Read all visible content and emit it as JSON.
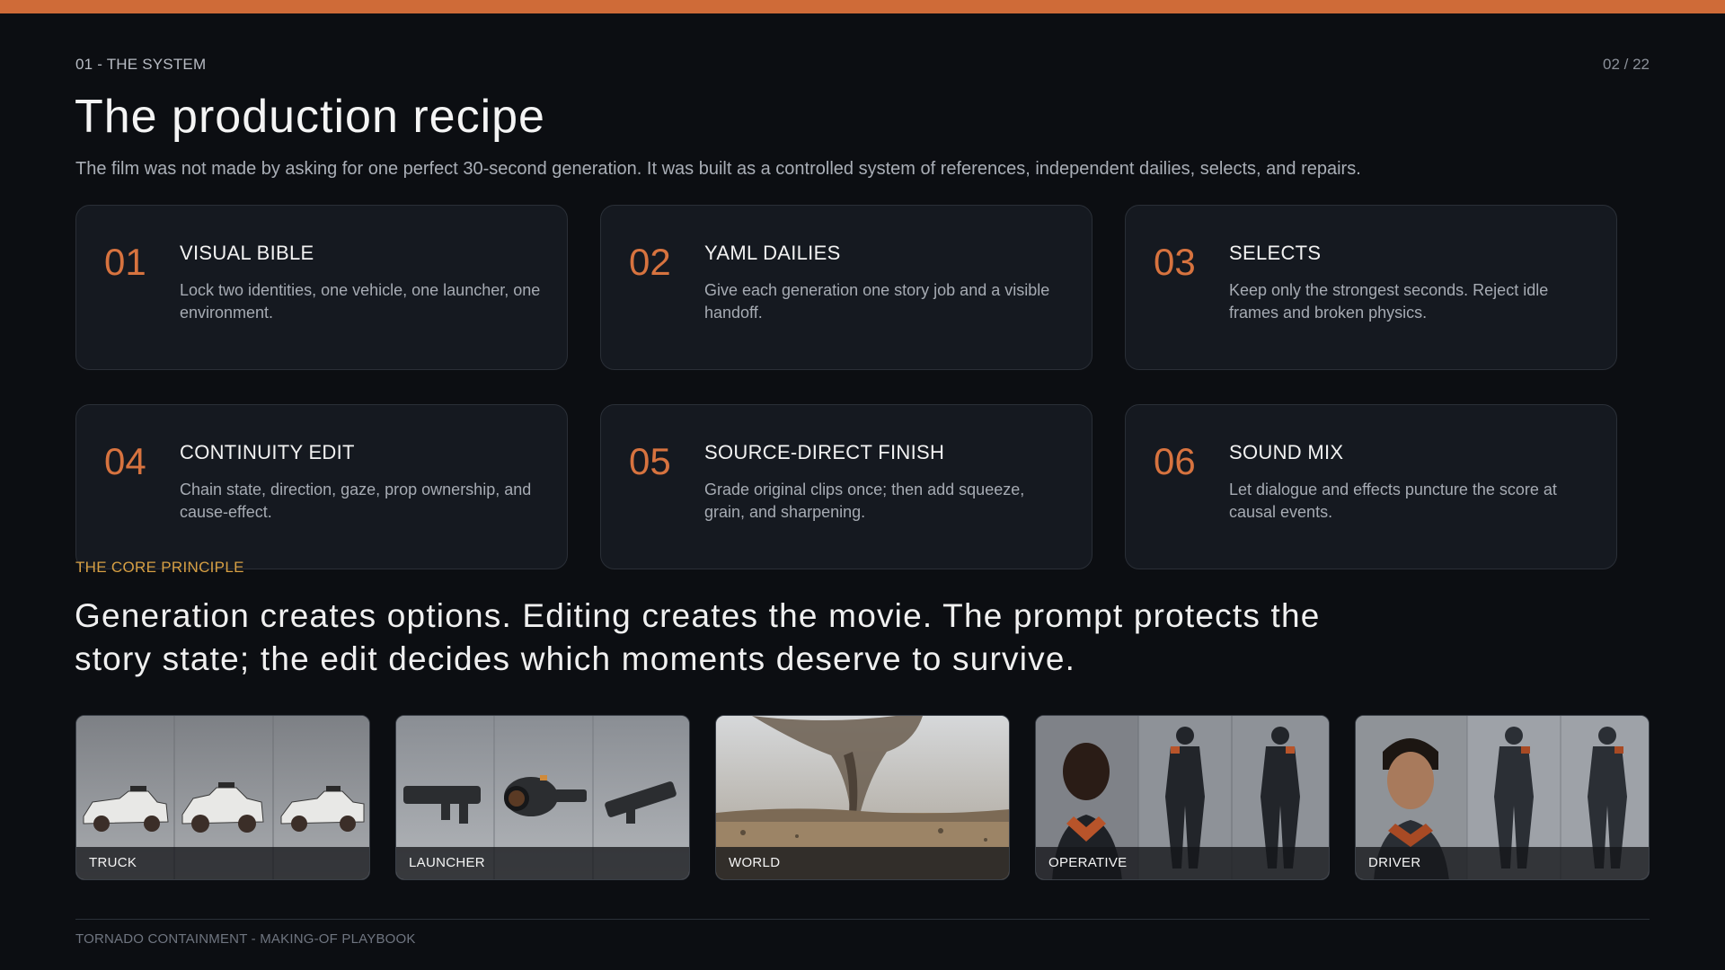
{
  "header": {
    "section_label": "01 - THE SYSTEM",
    "page_counter": "02 / 22",
    "title": "The production recipe",
    "subtitle": "The film was not made by asking for one perfect 30-second generation. It was built as a controlled system of references, independent dailies, selects, and repairs."
  },
  "steps": [
    {
      "num": "01",
      "title": "VISUAL BIBLE",
      "desc": "Lock two identities, one vehicle, one launcher, one environment."
    },
    {
      "num": "02",
      "title": "YAML DAILIES",
      "desc": "Give each generation one story job and a visible handoff."
    },
    {
      "num": "03",
      "title": "SELECTS",
      "desc": "Keep only the strongest seconds. Reject idle frames and broken physics."
    },
    {
      "num": "04",
      "title": "CONTINUITY EDIT",
      "desc": "Chain state, direction, gaze, prop ownership, and cause-effect."
    },
    {
      "num": "05",
      "title": "SOURCE-DIRECT FINISH",
      "desc": "Grade original clips once; then add squeeze, grain, and sharpening."
    },
    {
      "num": "06",
      "title": "SOUND MIX",
      "desc": "Let dialogue and effects puncture the score at causal events."
    }
  ],
  "principle": {
    "label": "THE CORE PRINCIPLE",
    "text": "Generation creates options. Editing creates the movie. The prompt protects the story state; the edit decides which moments deserve to survive."
  },
  "references": [
    {
      "caption": "TRUCK"
    },
    {
      "caption": "LAUNCHER"
    },
    {
      "caption": "WORLD"
    },
    {
      "caption": "OPERATIVE"
    },
    {
      "caption": "DRIVER"
    }
  ],
  "footer": {
    "text": "TORNADO CONTAINMENT - MAKING-OF PLAYBOOK"
  },
  "colors": {
    "accent": "#cf6b38",
    "step_number": "#d7733f",
    "principle_label": "#d7a044",
    "background": "#0c0e12",
    "card_background": "#151920"
  }
}
